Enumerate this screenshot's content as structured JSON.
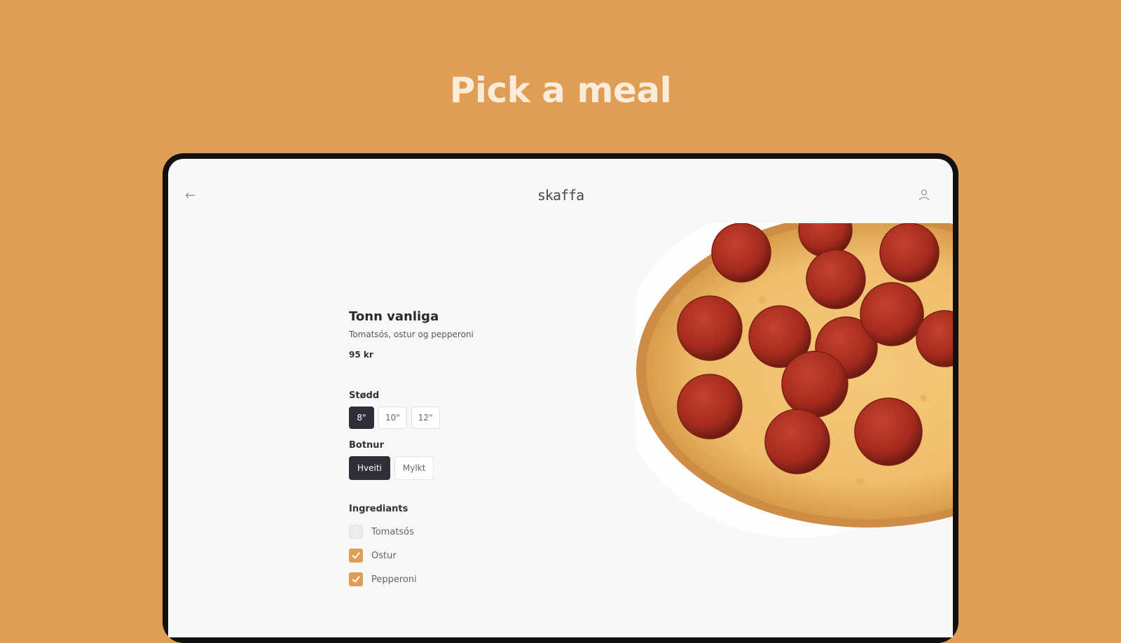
{
  "headline": "Pick a meal",
  "app": {
    "logo": "skaffa",
    "back_icon": "arrow-left-icon",
    "user_icon": "user-icon"
  },
  "product": {
    "title": "Tonn vanliga",
    "description": "Tomatsós, ostur og pepperoni",
    "price": "95 kr"
  },
  "size": {
    "label": "Stødd",
    "options": [
      "8\"",
      "10\"",
      "12\""
    ],
    "selected": "8\""
  },
  "crust": {
    "label": "Botnur",
    "options": [
      "Hveiti",
      "Mylkt"
    ],
    "selected": "Hveiti"
  },
  "ingredients": {
    "label": "Ingrediants",
    "items": [
      {
        "name": "Tomatsós",
        "checked": false
      },
      {
        "name": "Ostur",
        "checked": true
      },
      {
        "name": "Pepperoni",
        "checked": true
      }
    ]
  },
  "colors": {
    "background": "#E09D55",
    "accent": "#E09D55",
    "selected_chip": "#2E2F38"
  }
}
